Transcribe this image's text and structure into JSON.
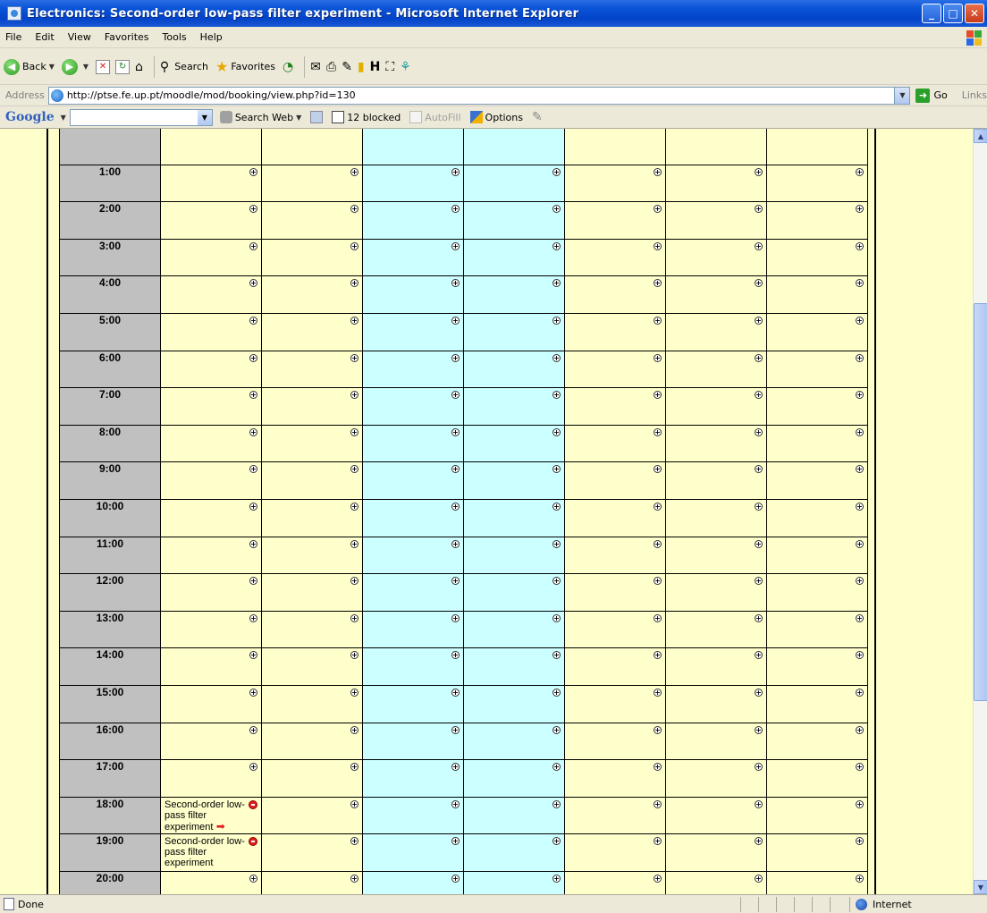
{
  "window": {
    "title": "Electronics: Second-order low-pass filter experiment - Microsoft Internet Explorer"
  },
  "menu": [
    "File",
    "Edit",
    "View",
    "Favorites",
    "Tools",
    "Help"
  ],
  "toolbar": {
    "back": "Back",
    "search": "Search",
    "favorites": "Favorites"
  },
  "address": {
    "label": "Address",
    "url": "http://ptse.fe.up.pt/moodle/mod/booking/view.php?id=130",
    "go": "Go",
    "links": "Links"
  },
  "google": {
    "logo": "Google",
    "search_web": "Search Web",
    "blocked": "12 blocked",
    "autofill": "AutoFill",
    "options": "Options"
  },
  "schedule": {
    "column_shading": [
      "yellow",
      "yellow",
      "cyan",
      "cyan",
      "yellow",
      "yellow",
      "yellow"
    ],
    "rows": [
      {
        "time": ""
      },
      {
        "time": "1:00"
      },
      {
        "time": "2:00"
      },
      {
        "time": "3:00"
      },
      {
        "time": "4:00"
      },
      {
        "time": "5:00"
      },
      {
        "time": "6:00"
      },
      {
        "time": "7:00"
      },
      {
        "time": "8:00"
      },
      {
        "time": "9:00"
      },
      {
        "time": "10:00"
      },
      {
        "time": "11:00"
      },
      {
        "time": "12:00"
      },
      {
        "time": "13:00"
      },
      {
        "time": "14:00"
      },
      {
        "time": "15:00"
      },
      {
        "time": "16:00"
      },
      {
        "time": "17:00"
      },
      {
        "time": "18:00",
        "booking": "Second-order low-pass filter experiment",
        "arrow": true
      },
      {
        "time": "19:00",
        "booking": "Second-order low-pass filter experiment"
      },
      {
        "time": "20:00"
      }
    ]
  },
  "status": {
    "left": "Done",
    "zone": "Internet"
  }
}
